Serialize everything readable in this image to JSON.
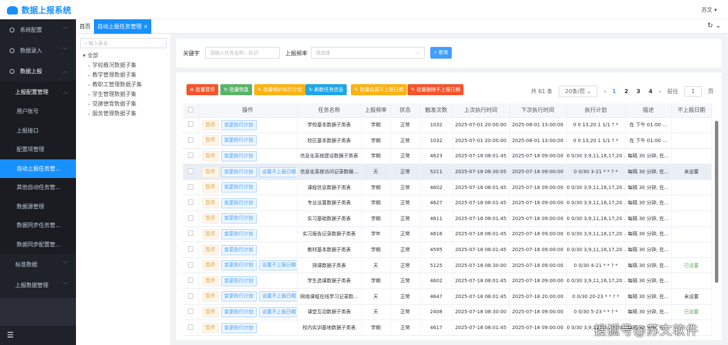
{
  "app": {
    "title": "数据上报系统",
    "user": "苏文"
  },
  "sidebar": {
    "items": [
      {
        "label": "系统配置"
      },
      {
        "label": "数据录入"
      },
      {
        "label": "数据上报"
      }
    ],
    "sub_group": "上报配置管理",
    "sub_items": [
      {
        "label": "用户账号"
      },
      {
        "label": "上报接口"
      },
      {
        "label": "配置项管理"
      },
      {
        "label": "自动上报任务管..."
      },
      {
        "label": "其他自动任务管..."
      },
      {
        "label": "数据源管理"
      },
      {
        "label": "数据同步任务管..."
      },
      {
        "label": "数据同步配置管..."
      }
    ],
    "after": [
      {
        "label": "标准数据"
      },
      {
        "label": "上报数据管理"
      }
    ]
  },
  "tabs": {
    "home": "首页",
    "active": "自动上报任务管理"
  },
  "tree": {
    "placeholder": "输入表名",
    "root": "全部",
    "children": [
      "学校概况数据子集",
      "教学管理数据子集",
      "教职工管理数据子集",
      "学生管理数据子集",
      "党建德育数据子集",
      "服务管理数据子集"
    ]
  },
  "filter": {
    "keyword_label": "关键字",
    "keyword_placeholder": "请输入任务名称、标识",
    "freq_label": "上报频率",
    "freq_placeholder": "请选择",
    "search": "查询"
  },
  "toolbar": {
    "buttons": [
      {
        "label": "⊗ 批量暂停",
        "color": "#f5542d"
      },
      {
        "label": "↻ 批量恢复",
        "color": "#5bb36b"
      },
      {
        "label": "✎ 批量维护执行计划",
        "color": "#fbb215"
      },
      {
        "label": "↻ 刷新任务信息",
        "color": "#1fa6e8"
      },
      {
        "label": "✎ 批量设置不上报日期",
        "color": "#fbb215"
      },
      {
        "label": "✎ 批量删除不上报日期",
        "color": "#f5542d"
      }
    ]
  },
  "pager": {
    "total": "共 61 条",
    "size": "20条/页",
    "pages": [
      "1",
      "2",
      "3",
      "4"
    ],
    "goto": "前往",
    "goto_value": "1",
    "page_unit": "页"
  },
  "table": {
    "headers": [
      "操作",
      "任务名称",
      "上报频率",
      "状态",
      "触发次数",
      "上次执行时间",
      "下次执行时间",
      "执行计划",
      "描述",
      "不上报日期"
    ],
    "op_pause": "暂停",
    "op_plan": "变更执行计划",
    "op_date": "设置不上报日期",
    "rows": [
      {
        "name": "学校基本数据子类表",
        "freq": "学期",
        "status": "正常",
        "count": "1032",
        "last": "2025-07-01 20:00:00",
        "next": "2025-08-01 13:00:00",
        "cron": "0 0 13,20 1 1/1 ? *",
        "desc": "在 下午 01:00 ...",
        "date": "",
        "setdate": false
      },
      {
        "name": "校区基本数据子类表",
        "freq": "学期",
        "status": "正常",
        "count": "1032",
        "last": "2025-07-01 20:00:00",
        "next": "2025-08-01 13:00:00",
        "cron": "0 0 13,20 1 1/1 ? *",
        "desc": "在 下午 01:00 ...",
        "date": "",
        "setdate": false
      },
      {
        "name": "信息化系统建设数据子类表",
        "freq": "学期",
        "status": "正常",
        "count": "4623",
        "last": "2025-07-18 08:01:45",
        "next": "2025-07-18 09:00:00",
        "cron": "0 0/30 3,9,11,16,17,20 ...",
        "desc": "每隔 30 分钟, 在...",
        "date": "",
        "setdate": false
      },
      {
        "name": "信息化系统访问记录数据...",
        "freq": "天",
        "status": "正常",
        "count": "5211",
        "last": "2025-07-18 08:30:05",
        "next": "2025-07-18 09:00:00",
        "cron": "0 0/30 3-21 * * ? *",
        "desc": "每隔 30 分钟, 在...",
        "date": "未设置",
        "setdate": true
      },
      {
        "name": "课程信息数据子类表",
        "freq": "学期",
        "status": "正常",
        "count": "4602",
        "last": "2025-07-18 08:01:45",
        "next": "2025-07-18 09:00:00",
        "cron": "0 0/30 3,9,11,16,17,20 ...",
        "desc": "每隔 30 分钟, 在...",
        "date": "",
        "setdate": false
      },
      {
        "name": "专业设置数据子类表",
        "freq": "学期",
        "status": "正常",
        "count": "4627",
        "last": "2025-07-18 08:01:45",
        "next": "2025-07-18 09:00:00",
        "cron": "0 0/30 3,9,11,16,17,20 ...",
        "desc": "每隔 30 分钟, 在...",
        "date": "",
        "setdate": false
      },
      {
        "name": "实习基础数据子类表",
        "freq": "学期",
        "status": "正常",
        "count": "4611",
        "last": "2025-07-18 08:01:45",
        "next": "2025-07-18 09:00:00",
        "cron": "0 0/30 3,9,11,16,17,20 ...",
        "desc": "每隔 30 分钟, 在...",
        "date": "",
        "setdate": false
      },
      {
        "name": "实习报告记录数据子类表",
        "freq": "学年",
        "status": "正常",
        "count": "4616",
        "last": "2025-07-18 08:01:45",
        "next": "2025-07-18 09:00:00",
        "cron": "0 0/30 3,9,11,16,17,20 ...",
        "desc": "每隔 30 分钟, 在...",
        "date": "",
        "setdate": false
      },
      {
        "name": "教材基本数据子类表",
        "freq": "学期",
        "status": "正常",
        "count": "4595",
        "last": "2025-07-18 08:01:45",
        "next": "2025-07-18 09:00:00",
        "cron": "0 0/30 3,9,11,16,17,20 ...",
        "desc": "每隔 30 分钟, 在...",
        "date": "",
        "setdate": false
      },
      {
        "name": "排课数据子类表",
        "freq": "天",
        "status": "正常",
        "count": "5125",
        "last": "2025-07-18 08:30:00",
        "next": "2025-07-18 09:00:00",
        "cron": "0 0/30 4-21 * * ? *",
        "desc": "每隔 30 分钟, 在...",
        "date": "已设置",
        "setdate": true
      },
      {
        "name": "学生选课数据子类表",
        "freq": "学期",
        "status": "正常",
        "count": "4602",
        "last": "2025-07-18 08:01:45",
        "next": "2025-07-18 09:00:00",
        "cron": "0 0/30 3,9,11,16,17,20 ...",
        "desc": "每隔 30 分钟, 在...",
        "date": "",
        "setdate": false
      },
      {
        "name": "网络课程在线学习记录数...",
        "freq": "天",
        "status": "正常",
        "count": "4647",
        "last": "2025-07-18 08:01:45",
        "next": "2025-07-18 20:00:00",
        "cron": "0 0/30 20-23 * * ? *",
        "desc": "每隔 30 分钟, 在...",
        "date": "未设置",
        "setdate": true
      },
      {
        "name": "课堂互动数据子类表",
        "freq": "天",
        "status": "正常",
        "count": "2408",
        "last": "2025-07-18 08:30:00",
        "next": "2025-07-18 09:00:00",
        "cron": "0 0/30 5-23 * * ? *",
        "desc": "每隔 30 分钟, 在...",
        "date": "已设置",
        "setdate": true
      },
      {
        "name": "校内实训基地数据子类表",
        "freq": "学期",
        "status": "正常",
        "count": "4617",
        "last": "2025-07-18 08:01:45",
        "next": "2025-07-18 09:00:00",
        "cron": "0 0/30 3,9,11,16,17,20 ...",
        "desc": "每隔 30 分钟, 在...",
        "date": "",
        "setdate": false
      }
    ]
  },
  "watermark": "搜狐号@苏文软件"
}
